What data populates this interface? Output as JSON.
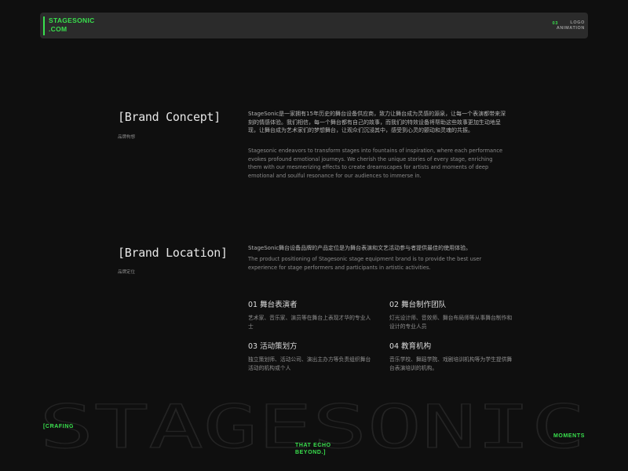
{
  "header": {
    "brand_line1": "STAGESONIC",
    "brand_line2": ".COM",
    "section_number": "03",
    "section_line1": "LOGO",
    "section_line2": "ANIMATION"
  },
  "brand_concept": {
    "heading": "[Brand Concept]",
    "subheading": "品牌构想",
    "text_cn": "StageSonic是一家拥有15年历史的舞台设备供应商，致力让舞台成为灵感的源泉，让每一个表演都带来深刻的情感体验。我们相信，每一个舞台都有自己的故事，而我们的特效设备将帮助这些故事更加生动地呈现，让舞台成为艺术家们的梦想舞台，让观众们沉浸其中，感受到心灵的颤动和灵魂的共振。",
    "text_en": "Stagesonic endeavors to transform stages into fountains of inspiration, where each performance evokes profound emotional journeys. We cherish the unique stories of every stage, enriching them with our mesmerizing effects to create dreamscapes for artists and moments of deep emotional and soulful resonance for our audiences to immerse in."
  },
  "brand_location": {
    "heading": "[Brand Location]",
    "subheading": "品牌定位",
    "text_cn": "StageSonic舞台设备品牌的产品定位是为舞台表演和文艺活动参与者提供最佳的使用体验。",
    "text_en": "The product positioning of Stagesonic stage equipment brand is to provide the best user experience for stage performers and participants in artistic activities."
  },
  "audiences": [
    {
      "title": "01 舞台表演者",
      "desc": "艺术家、音乐家、演员等在舞台上表现才华的专业人士"
    },
    {
      "title": "02 舞台制作团队",
      "desc": "灯光设计师、音效师、舞台布局师等从事舞台制作和设计的专业人员"
    },
    {
      "title": "03 活动策划方",
      "desc": "独立策划师、活动公司、演出主办方等负责组织舞台活动的机构或个人"
    },
    {
      "title": "04 教育机构",
      "desc": "音乐学校、舞蹈学院、戏剧培训机构等为学生提供舞台表演培训的机构。"
    }
  ],
  "footer": {
    "watermark": "STAGESONIC",
    "tag_left": "[CRAFING",
    "tag_mid_line1": "THAT ECHO",
    "tag_mid_line2": "BEYOND.]",
    "tag_right": "MOMENTS"
  },
  "colors": {
    "accent": "#39e04d",
    "background": "#0f0f0f",
    "bar": "#2b2b2b"
  }
}
